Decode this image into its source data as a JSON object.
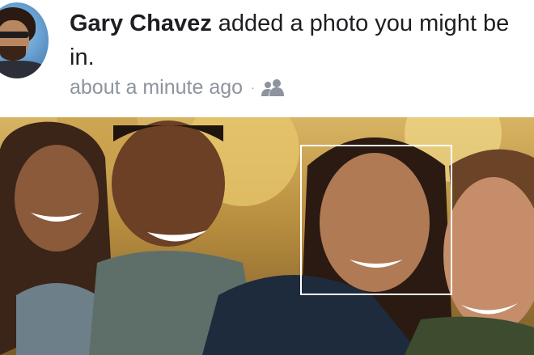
{
  "post": {
    "actor_name": "Gary Chavez",
    "action_text": " added a photo you might be in.",
    "timestamp": "about a minute ago",
    "separator": "·",
    "audience_icon": "friends-icon"
  },
  "photo": {
    "tagged_faces": 1
  },
  "colors": {
    "text_primary": "#1c1e21",
    "text_secondary": "#8d949e",
    "face_tag_border": "#ffffff"
  }
}
